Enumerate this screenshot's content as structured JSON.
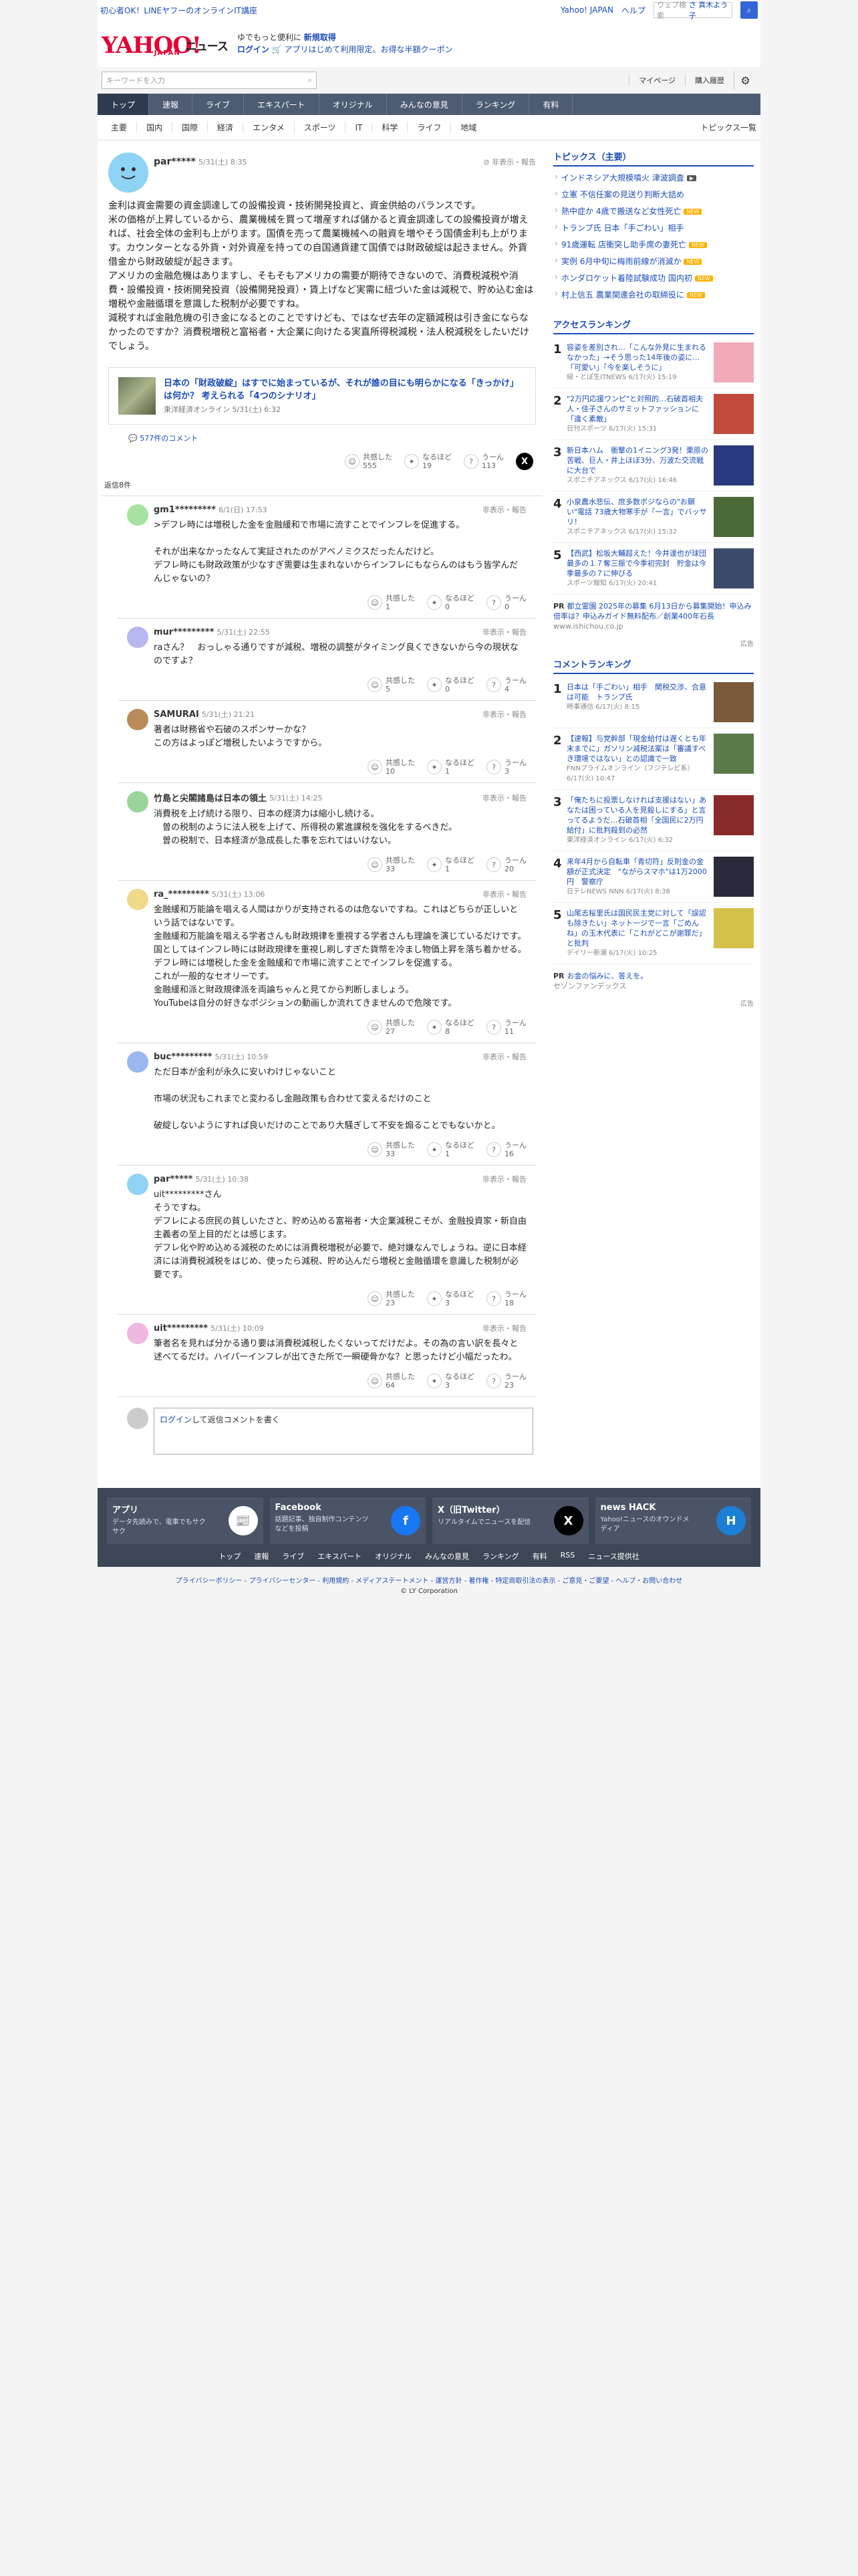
{
  "top": {
    "left_link": "初心者OK！LINEヤフーのオンラインIT講座",
    "links": [
      "Yahoo! JAPAN",
      "ヘルプ"
    ],
    "search_placeholder": "ウェブ検索",
    "search_user": "さ 真木よう子"
  },
  "header": {
    "logo": "YAHOO!",
    "logo_jp": "JAPAN",
    "news": "ニュース",
    "promo1_prefix": "ゆでもっと便利に",
    "promo1_link": "新規取得",
    "promo2_login": "ログイン",
    "promo2_text": "アプリはじめて利用限定。お得な半額クーポン"
  },
  "search": {
    "placeholder": "キーワードを入力",
    "mypage": "マイページ",
    "history": "購入履歴"
  },
  "nav": [
    "トップ",
    "速報",
    "ライブ",
    "エキスパート",
    "オリジナル",
    "みんなの意見",
    "ランキング",
    "有料"
  ],
  "subnav": [
    "主要",
    "国内",
    "国際",
    "経済",
    "エンタメ",
    "スポーツ",
    "IT",
    "科学",
    "ライフ",
    "地域"
  ],
  "subnav_right": "トピックス一覧",
  "main_post": {
    "name": "par*****",
    "date": "5/31(土) 8:35",
    "report": "非表示・報告",
    "body": "金利は資金需要の資金調達しての設備投資・技術開発投資と、資金供給のバランスです。\n米の価格が上昇しているから、農業機械を買って増産すれば儲かると資金調達しての設備投資が増えれば、社会全体の金利も上がります。国債を売って農業機械への融資を増やそう国債金利も上がります。カウンターとなる外貨・対外資産を持っての自国通貨建て国債では財政破綻は起きません。外貨借金から財政破綻が起きます。\nアメリカの金融危機はありますし、そもそもアメリカの需要が期待できないので、消費税減税や消費・設備投資・技術開発投資（設備開発投資）・賃上げなど実需に紐づいた金は減税で、貯め込む金は増税や金融循環を意識した税制が必要ですね。\n減税すれば金融危機の引き金になるとのことですけども、ではなぜ去年の定額減税は引き金にならなかったのですか？消費税増税と富裕者・大企業に向けたる実直所得税減税・法人税減税をしたいだけでしょう。",
    "article_title": "日本の「財政破綻」はすでに始まっているが、それが誰の目にも明らかになる「きっかけ」は何か？ 考えられる「4つのシナリオ」",
    "article_src": "東洋経済オンライン 5/31(土) 6:32",
    "comment_count": "577件のコメント",
    "r1": "共感した",
    "r1n": "555",
    "r2": "なるほど",
    "r2n": "19",
    "r3": "うーん",
    "r3n": "113"
  },
  "reply_count": "返信8件",
  "replies": [
    {
      "name": "gm1*********",
      "date": "6/1(日) 17:53",
      "text": ">デフレ時には増税した金を金融緩和で市場に流すことでインフレを促進する。\n\nそれが出来なかったなんて実証されたのがアベノミクスだったんだけど。\nデフレ時にも財政政策が少なすぎ需要は生まれないからインフレにもならんのはもう皆学んだんじゃないの？",
      "n": [
        "1",
        "0",
        "0"
      ]
    },
    {
      "name": "mur*********",
      "date": "5/31(土) 22:55",
      "text": "raさん？　おっしゃる通りですが減税、増税の調整がタイミング良くできないから今の現状なのですよ？",
      "n": [
        "5",
        "0",
        "4"
      ]
    },
    {
      "name": "SAMURAI",
      "date": "5/31(土) 21:21",
      "text": "著者は財務省や石破のスポンサーかな？\nこの方はよっぽど増税したいようですから。",
      "n": [
        "10",
        "1",
        "3"
      ]
    },
    {
      "name": "竹島と尖閣諸島は日本の領土",
      "date": "5/31(土) 14:25",
      "text": "消費税を上げ続ける限り、日本の経済力は縮小し続ける。\n　曽の税制のように法人税を上げて、所得税の累進課税を強化をするべきだ。\n　曽の税制で、日本経済が急成長した事を忘れてはいけない。",
      "n": [
        "33",
        "1",
        "20"
      ]
    },
    {
      "name": "ra_*********",
      "date": "5/31(土) 13:06",
      "text": "金融緩和万能論を唱える人間はかりが支持されるのは危ないですね。これはどちらが正しいという話ではないです。\n金融緩和万能論を唱える学者さんも財政規律を重視する学者さんも理論を演じているだけです。\n国としてはインフレ時には財政規律を重視し刷しすぎた貨幣を冷まし物価上昇を落ち着かせる。デフレ時には増税した金を金融緩和で市場に流すことでインフレを促進する。\nこれが一般的なセオリーです。\n金融緩和派と財政規律派を両論ちゃんと見てから判断しましょう。\nYouTubeは自分の好きなポジションの動画しか流れてきませんので危険です。",
      "n": [
        "27",
        "8",
        "11"
      ]
    },
    {
      "name": "buc*********",
      "date": "5/31(土) 10:59",
      "text": "ただ日本が金利が永久に安いわけじゃないこと\n\n市場の状況もこれまでと変わるし金融政策も合わせて変えるだけのこと\n\n破綻しないようにすれば良いだけのことであり大騒ぎして不安を煽ることでもないかと。",
      "n": [
        "33",
        "1",
        "16"
      ]
    },
    {
      "name": "par*****",
      "date": "5/31(土) 10:38",
      "text": "uit*********さん\nそうですね。\nデフレによる庶民の貧しいたさと、貯め込める富裕者・大企業減税こそが、金融投資家・新自由主義者の至上目的だとは感じます。\nデフレ化や貯め込める減税のためには消費税増税が必要で、絶対嫌なんでしょうね。逆に日本経済には消費税減税をはじめ、使ったら減税、貯め込んだら増税と金融循環を意識した税制が必要です。",
      "n": [
        "23",
        "3",
        "18"
      ]
    },
    {
      "name": "uit*********",
      "date": "5/31(土) 10:09",
      "text": "筆者名を見れば分かる通り要は消費税減税したくないってだけだよ。その為の言い訳を長々と述べてるだけ。ハイパーインフレが出てきた所で一瞬硬骨かな？と思ったけど小幅だったわ。",
      "n": [
        "64",
        "3",
        "23"
      ]
    }
  ],
  "reply_labels": [
    "共感した",
    "なるほど",
    "うーん"
  ],
  "login_comment": {
    "link": "ログイン",
    "text": "して返信コメントを書く"
  },
  "side": {
    "topics_head": "トピックス（主要）",
    "topics": [
      "インドネシア大規模噴火 津波調査",
      "立憲 不信任案の見送り判断大詰め",
      "熱中症か 4歳で搬送など女性死亡",
      "トランプ氏 日本「手ごわい」相手",
      "91歳運転 店衝突し助手席の妻死亡",
      "実例 6月中旬に梅雨前線が消滅か",
      "ホンダロケット着陸試験成功 国内初",
      "村上信五 農業関連会社の取締役に"
    ],
    "topic_badges": [
      "video",
      "",
      "new",
      "",
      "new",
      "new",
      "new",
      "new"
    ],
    "access_head": "アクセスランキング",
    "access": [
      {
        "n": "1",
        "t": "容姿を差別され…「こんな外見に生まれるなかった」→そう思った14年後の姿に…「可愛い」「今を楽しそうに」",
        "m": "緑・とぽ生ITNEWS 6/17(火) 15:19",
        "img": "#f2a9b8"
      },
      {
        "n": "2",
        "t": "\"2万円応援ワンピ\"と対照的…石破首相夫人・佳子さんのサミットファッションに「違く素敵」",
        "m": "日刊スポーツ 6/17(火) 15:31",
        "img": "#c24a3a"
      },
      {
        "n": "3",
        "t": "新日本ハム　衝撃の1イニング3発！栗原の苦戦、巨人・井上ほぼ3分、万波た交流戦に大台で",
        "m": "スポニチアネックス 6/17(火) 16:46",
        "img": "#2a3a80"
      },
      {
        "n": "4",
        "t": "小泉農水悲伝、庶多数ポジならの\"お願い\"電話 73歳大物寒手が「一言」でバッサリ！",
        "m": "スポニチアネックス 6/17(火) 15:32",
        "img": "#4a6a3a"
      },
      {
        "n": "5",
        "t": "【西武】松坂大輔超えた！今井達也が球団最多の１７奪三振で今季初完封　貯金は今季最多の７に伸びる",
        "m": "スポーツ報知 6/17(火) 20:41",
        "img": "#3a4a6a"
      }
    ],
    "pr1": {
      "p": "PR",
      "t": "都立霊園 2025年の募集 6月13日から募集開始！申込み倍率は？申込みガイド無料配布／創業400年石長",
      "url": "www.ishichou.co.jp"
    },
    "ad": "広告",
    "comment_head": "コメントランキング",
    "comment": [
      {
        "n": "1",
        "t": "日本は「手ごわい」相手　関税交渉、合意は可能　トランプ氏",
        "m": "時事通信 6/17(火) 8:15",
        "img": "#7a5a3a"
      },
      {
        "n": "2",
        "t": "【速報】与党幹部「現金給付は遅くとも年末までに」ガソリン減税法案は「審議すべき環境ではない」との認識で一致",
        "m": "FNNプライムオンライン（フジテレビ系）6/17(火) 10:47",
        "img": "#5a7a4a"
      },
      {
        "n": "3",
        "t": "「俺たちに投票しなければ支援はない」あなたは困っている人を見殺しにする」と言ってるようだ…石破首相「全国民に2万円給付」に批判殺到の必然",
        "m": "東洋経済オンライン 6/17(火) 6:32",
        "img": "#8a2a2a"
      },
      {
        "n": "4",
        "t": "来年4月から自転車「青切符」反則金の金額が正式決定　\"ながらスマホ\"は1万2000円　警察庁",
        "m": "日テレNEWS NNN 6/17(火) 8:38",
        "img": "#2a2a3a"
      },
      {
        "n": "5",
        "t": "山尾志桜里氏は国民民主党に対して「誤認も除きたい」ネット一ジで一言「ごめんね」の玉木代表に「これがどこが謝罪だ」と批判",
        "m": "デイリー新潮 6/17(火) 10:25",
        "img": "#d4c14a"
      }
    ],
    "pr2": {
      "p": "PR",
      "t": "お金の悩みに、答えを。",
      "url": "セゾンファンデックス"
    }
  },
  "footer": {
    "cards": [
      {
        "t": "アプリ",
        "d": "データ先読みで、電車でもサクサク",
        "ic": "app-icon"
      },
      {
        "t": "Facebook",
        "d": "話題記事、独自制作コンテンツなどを投稿",
        "ic": "facebook-icon"
      },
      {
        "t": "X（旧Twitter）",
        "d": "リアルタイムでニュースを配信",
        "ic": "x-icon"
      },
      {
        "t": "news HACK",
        "d": "Yahoo!ニュースのオウンドメディア",
        "ic": "hack-icon"
      }
    ],
    "links": [
      "トップ",
      "速報",
      "ライブ",
      "エキスパート",
      "オリジナル",
      "みんなの意見",
      "ランキング",
      "有料",
      "RSS",
      "ニュース提供社"
    ],
    "legal": "プライバシーポリシー - プライバシーセンター - 利用規約 - メディアステートメント - 運営方針 - 著作権 - 特定商取引法の表示 - ご意見・ご要望 - ヘルプ・お問い合わせ",
    "copy": "© LY Corporation"
  }
}
